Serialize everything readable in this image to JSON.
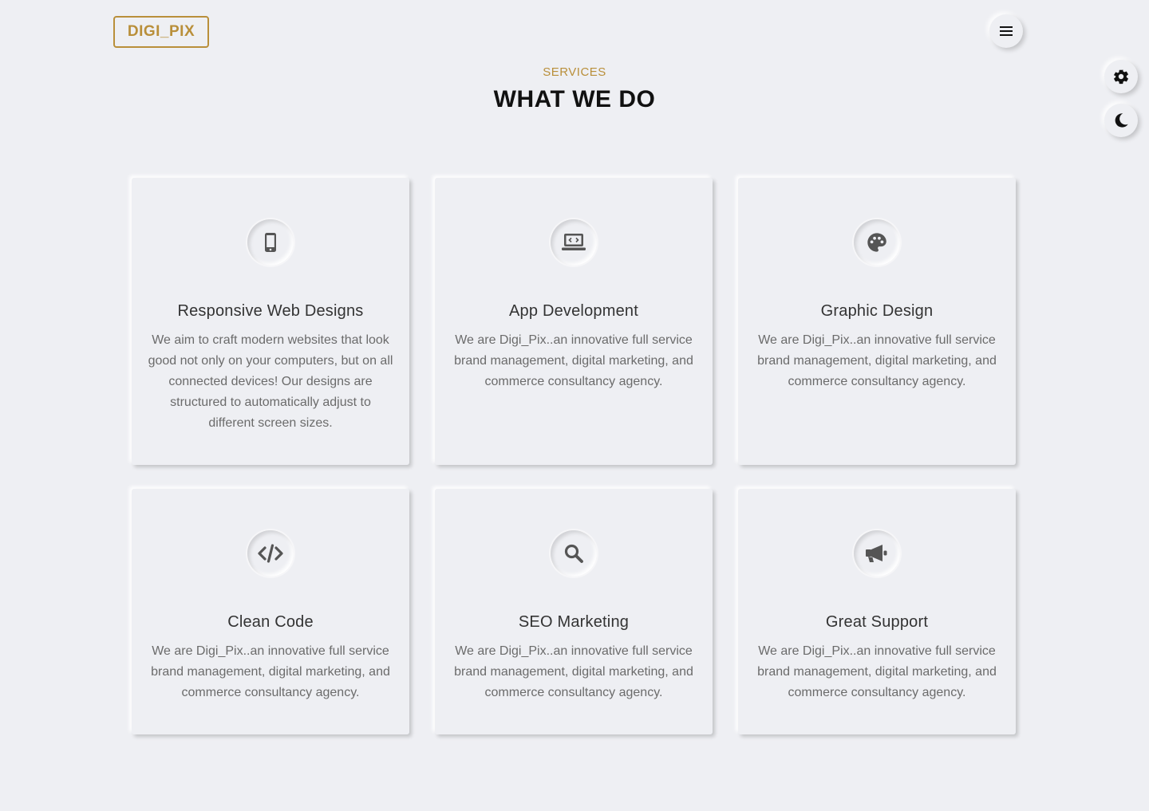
{
  "header": {
    "logo_text": "DIGI_PIX",
    "menu_icon": "hamburger-menu-icon"
  },
  "side_controls": {
    "settings_icon": "gear-icon",
    "theme_icon": "moon-icon"
  },
  "section": {
    "eyebrow": "SERVICES",
    "title": "WHAT WE DO"
  },
  "services": [
    {
      "icon": "mobile-phone-icon",
      "title": "Responsive Web Designs",
      "description": "We aim to craft modern websites that look good not only on your computers, but on all connected devices! Our designs are structured to automatically adjust to different screen sizes."
    },
    {
      "icon": "laptop-code-icon",
      "title": "App Development",
      "description": "We are Digi_Pix..an innovative full service brand management, digital marketing, and commerce consultancy agency."
    },
    {
      "icon": "palette-icon",
      "title": "Graphic Design",
      "description": "We are Digi_Pix..an innovative full service brand management, digital marketing, and commerce consultancy agency."
    },
    {
      "icon": "code-icon",
      "title": "Clean Code",
      "description": "We are Digi_Pix..an innovative full service brand management, digital marketing, and commerce consultancy agency."
    },
    {
      "icon": "search-icon",
      "title": "SEO Marketing",
      "description": "We are Digi_Pix..an innovative full service brand management, digital marketing, and commerce consultancy agency."
    },
    {
      "icon": "megaphone-icon",
      "title": "Great Support",
      "description": "We are Digi_Pix..an innovative full service brand management, digital marketing, and commerce consultancy agency."
    }
  ],
  "colors": {
    "accent": "#b98f3a",
    "background": "#eeeff3",
    "heading": "#111111",
    "icon": "#555555"
  }
}
